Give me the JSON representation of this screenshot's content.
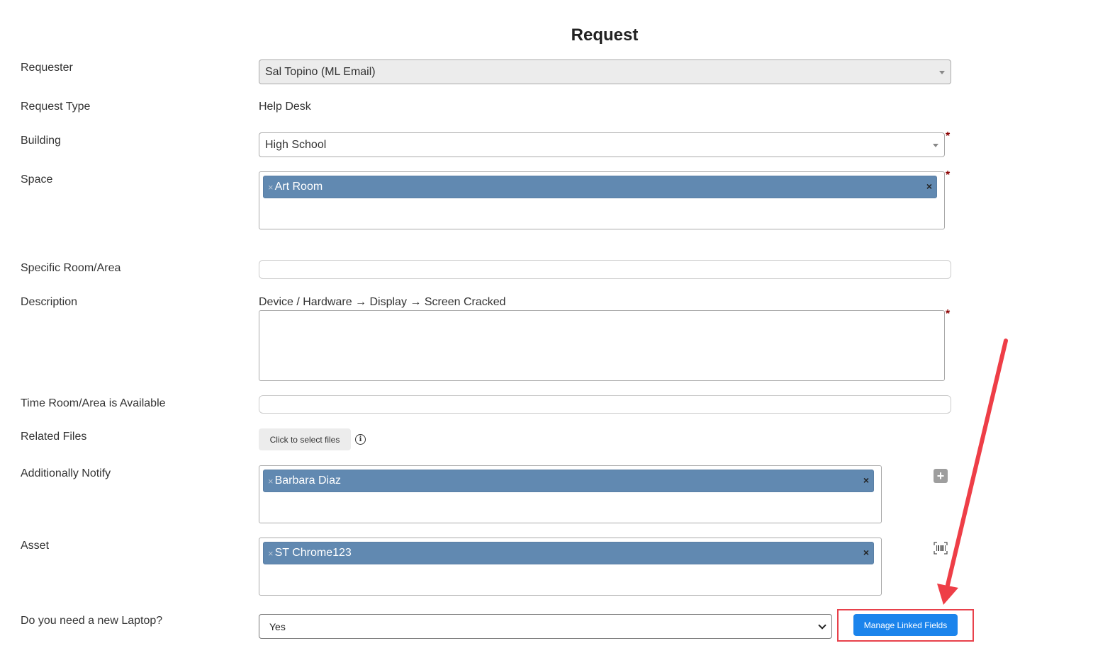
{
  "page": {
    "title": "Request"
  },
  "fields": {
    "requester": {
      "label": "Requester",
      "value": "Sal Topino (ML Email)"
    },
    "request_type": {
      "label": "Request Type",
      "value": "Help Desk"
    },
    "building": {
      "label": "Building",
      "value": "High School",
      "required_mark": "*"
    },
    "space": {
      "label": "Space",
      "chips": [
        "Art Room"
      ],
      "required_mark": "*",
      "chip_remove": "×"
    },
    "specific_room": {
      "label": "Specific Room/Area",
      "value": ""
    },
    "description": {
      "label": "Description",
      "path": "Device / Hardware → Display → Screen Cracked",
      "value": "",
      "required_mark": "*"
    },
    "time_available": {
      "label": "Time Room/Area is Available",
      "value": ""
    },
    "related_files": {
      "label": "Related Files",
      "button_label": "Click to select files",
      "info_glyph": "i"
    },
    "additionally_notify": {
      "label": "Additionally Notify",
      "chips": [
        "Barbara Diaz"
      ],
      "add_glyph": "+"
    },
    "asset": {
      "label": "Asset",
      "chips": [
        "ST Chrome123"
      ]
    },
    "new_laptop": {
      "label": "Do you need a new Laptop?",
      "value": "Yes",
      "options": [
        "Yes"
      ]
    }
  },
  "actions": {
    "manage_linked_fields": "Manage Linked Fields"
  },
  "icons": {
    "add": "plus-icon",
    "barcode": "barcode-scan-icon",
    "info": "info-icon",
    "remove": "close-icon"
  },
  "colors": {
    "chip": "#6189b1",
    "primary_button": "#1b84ec",
    "annotation": "#e8414b",
    "required": "#8b0000"
  }
}
